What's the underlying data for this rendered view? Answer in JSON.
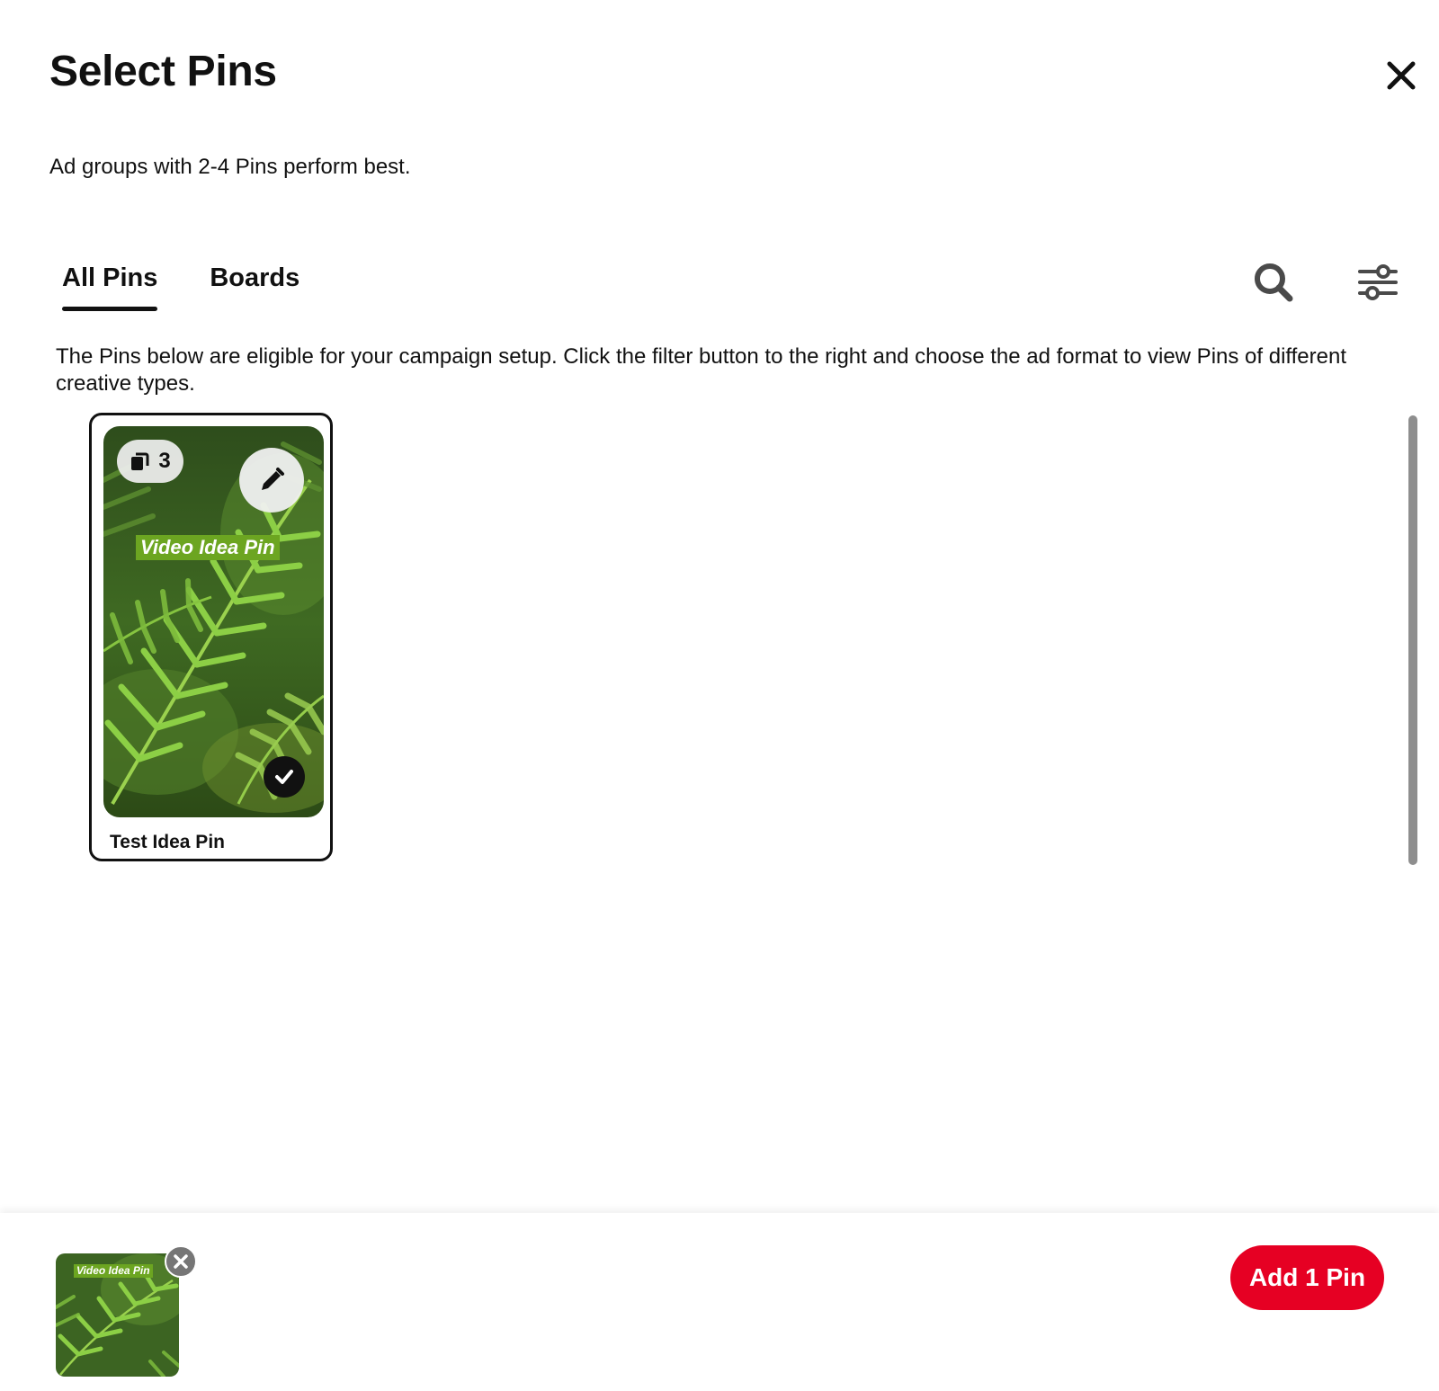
{
  "header": {
    "title": "Select Pins",
    "close_icon": "close-icon"
  },
  "subtitle": "Ad groups with 2-4 Pins perform best.",
  "tabs": [
    {
      "label": "All Pins",
      "active": true
    },
    {
      "label": "Boards",
      "active": false
    }
  ],
  "toolbar": {
    "search_icon": "search-icon",
    "filter_icon": "filter-sliders-icon"
  },
  "info_text": "The Pins below are eligible for your campaign setup. Click the filter button to the right and choose the ad format to view Pins of different creative types.",
  "pins": [
    {
      "title": "Test Idea Pin",
      "page_count": "3",
      "overlay_text": "Video Idea Pin",
      "selected": true
    }
  ],
  "selected_tray": {
    "items": [
      {
        "overlay_text": "Video Idea Pin"
      }
    ]
  },
  "footer": {
    "add_button_label": "Add 1 Pin"
  },
  "colors": {
    "accent_red": "#e60023",
    "overlay_green": "#6ca521",
    "text_dark": "#111111"
  }
}
